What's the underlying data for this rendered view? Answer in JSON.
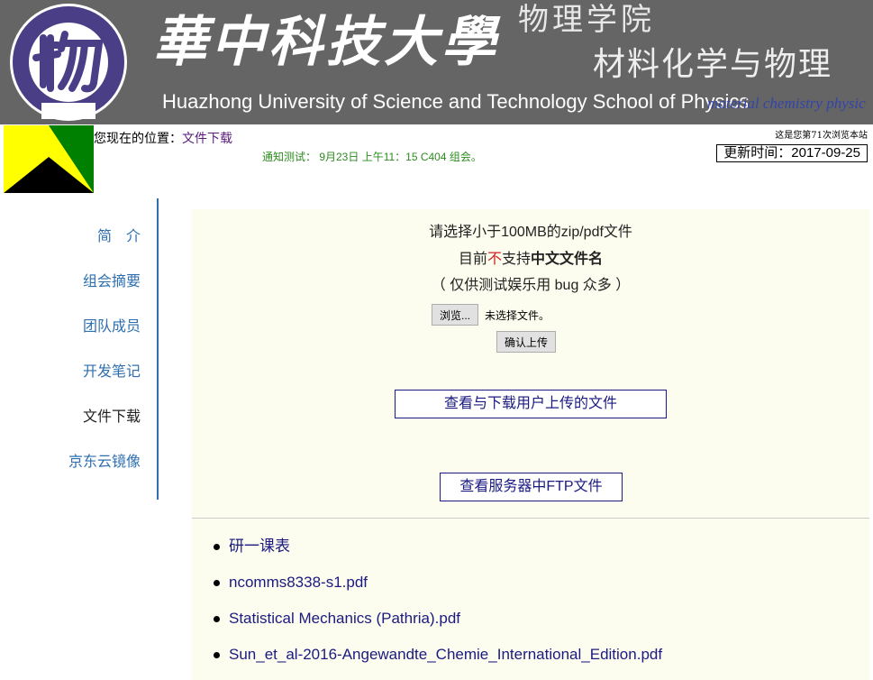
{
  "header": {
    "seal_text": "HUST 华中科技大学物理学院 PHYSICS",
    "seal_year": "1983",
    "university_cn": "華中科技大學",
    "school_cn": "物理学院",
    "lab_cn": "材料化学与物理",
    "university_en": "Huazhong University of  Science and Technology School of Physics",
    "lab_en": "material chemistry physic"
  },
  "location": {
    "label": "您现在的位置：",
    "current": "文件下载"
  },
  "notice": "通知测试： 9月23日 上午11：15 C404 组会。",
  "visits": "这是您第71次浏览本站",
  "updated": "更新时间：2017-09-25",
  "sidebar": {
    "items": [
      {
        "label": "简　介"
      },
      {
        "label": "组会摘要"
      },
      {
        "label": "团队成员"
      },
      {
        "label": "开发笔记"
      },
      {
        "label": "文件下载"
      },
      {
        "label": "京东云镜像"
      }
    ]
  },
  "upload": {
    "title": "请选择小于100MB的zip/pdf文件",
    "warn_prefix": "目前",
    "warn_red": "不",
    "warn_mid": "支持",
    "warn_bold": "中文文件名",
    "note": "（ 仅供测试娱乐用 bug 众多 ）",
    "browse_label": "浏览...",
    "no_file": "未选择文件。",
    "submit_label": "确认上传"
  },
  "links": {
    "view_uploads": "查看与下载用户上传的文件",
    "view_ftp": "查看服务器中FTP文件"
  },
  "files": [
    "研一课表",
    "ncomms8338-s1.pdf",
    "Statistical Mechanics (Pathria).pdf",
    "Sun_et_al-2016-Angewandte_Chemie_International_Edition.pdf"
  ],
  "colors": {
    "banner": "#656565",
    "logo_yellow": "#ffff00",
    "logo_green": "#008000",
    "logo_black": "#000000",
    "nav_blue": "#2f6fb0",
    "main_bg": "#fdfdef"
  }
}
